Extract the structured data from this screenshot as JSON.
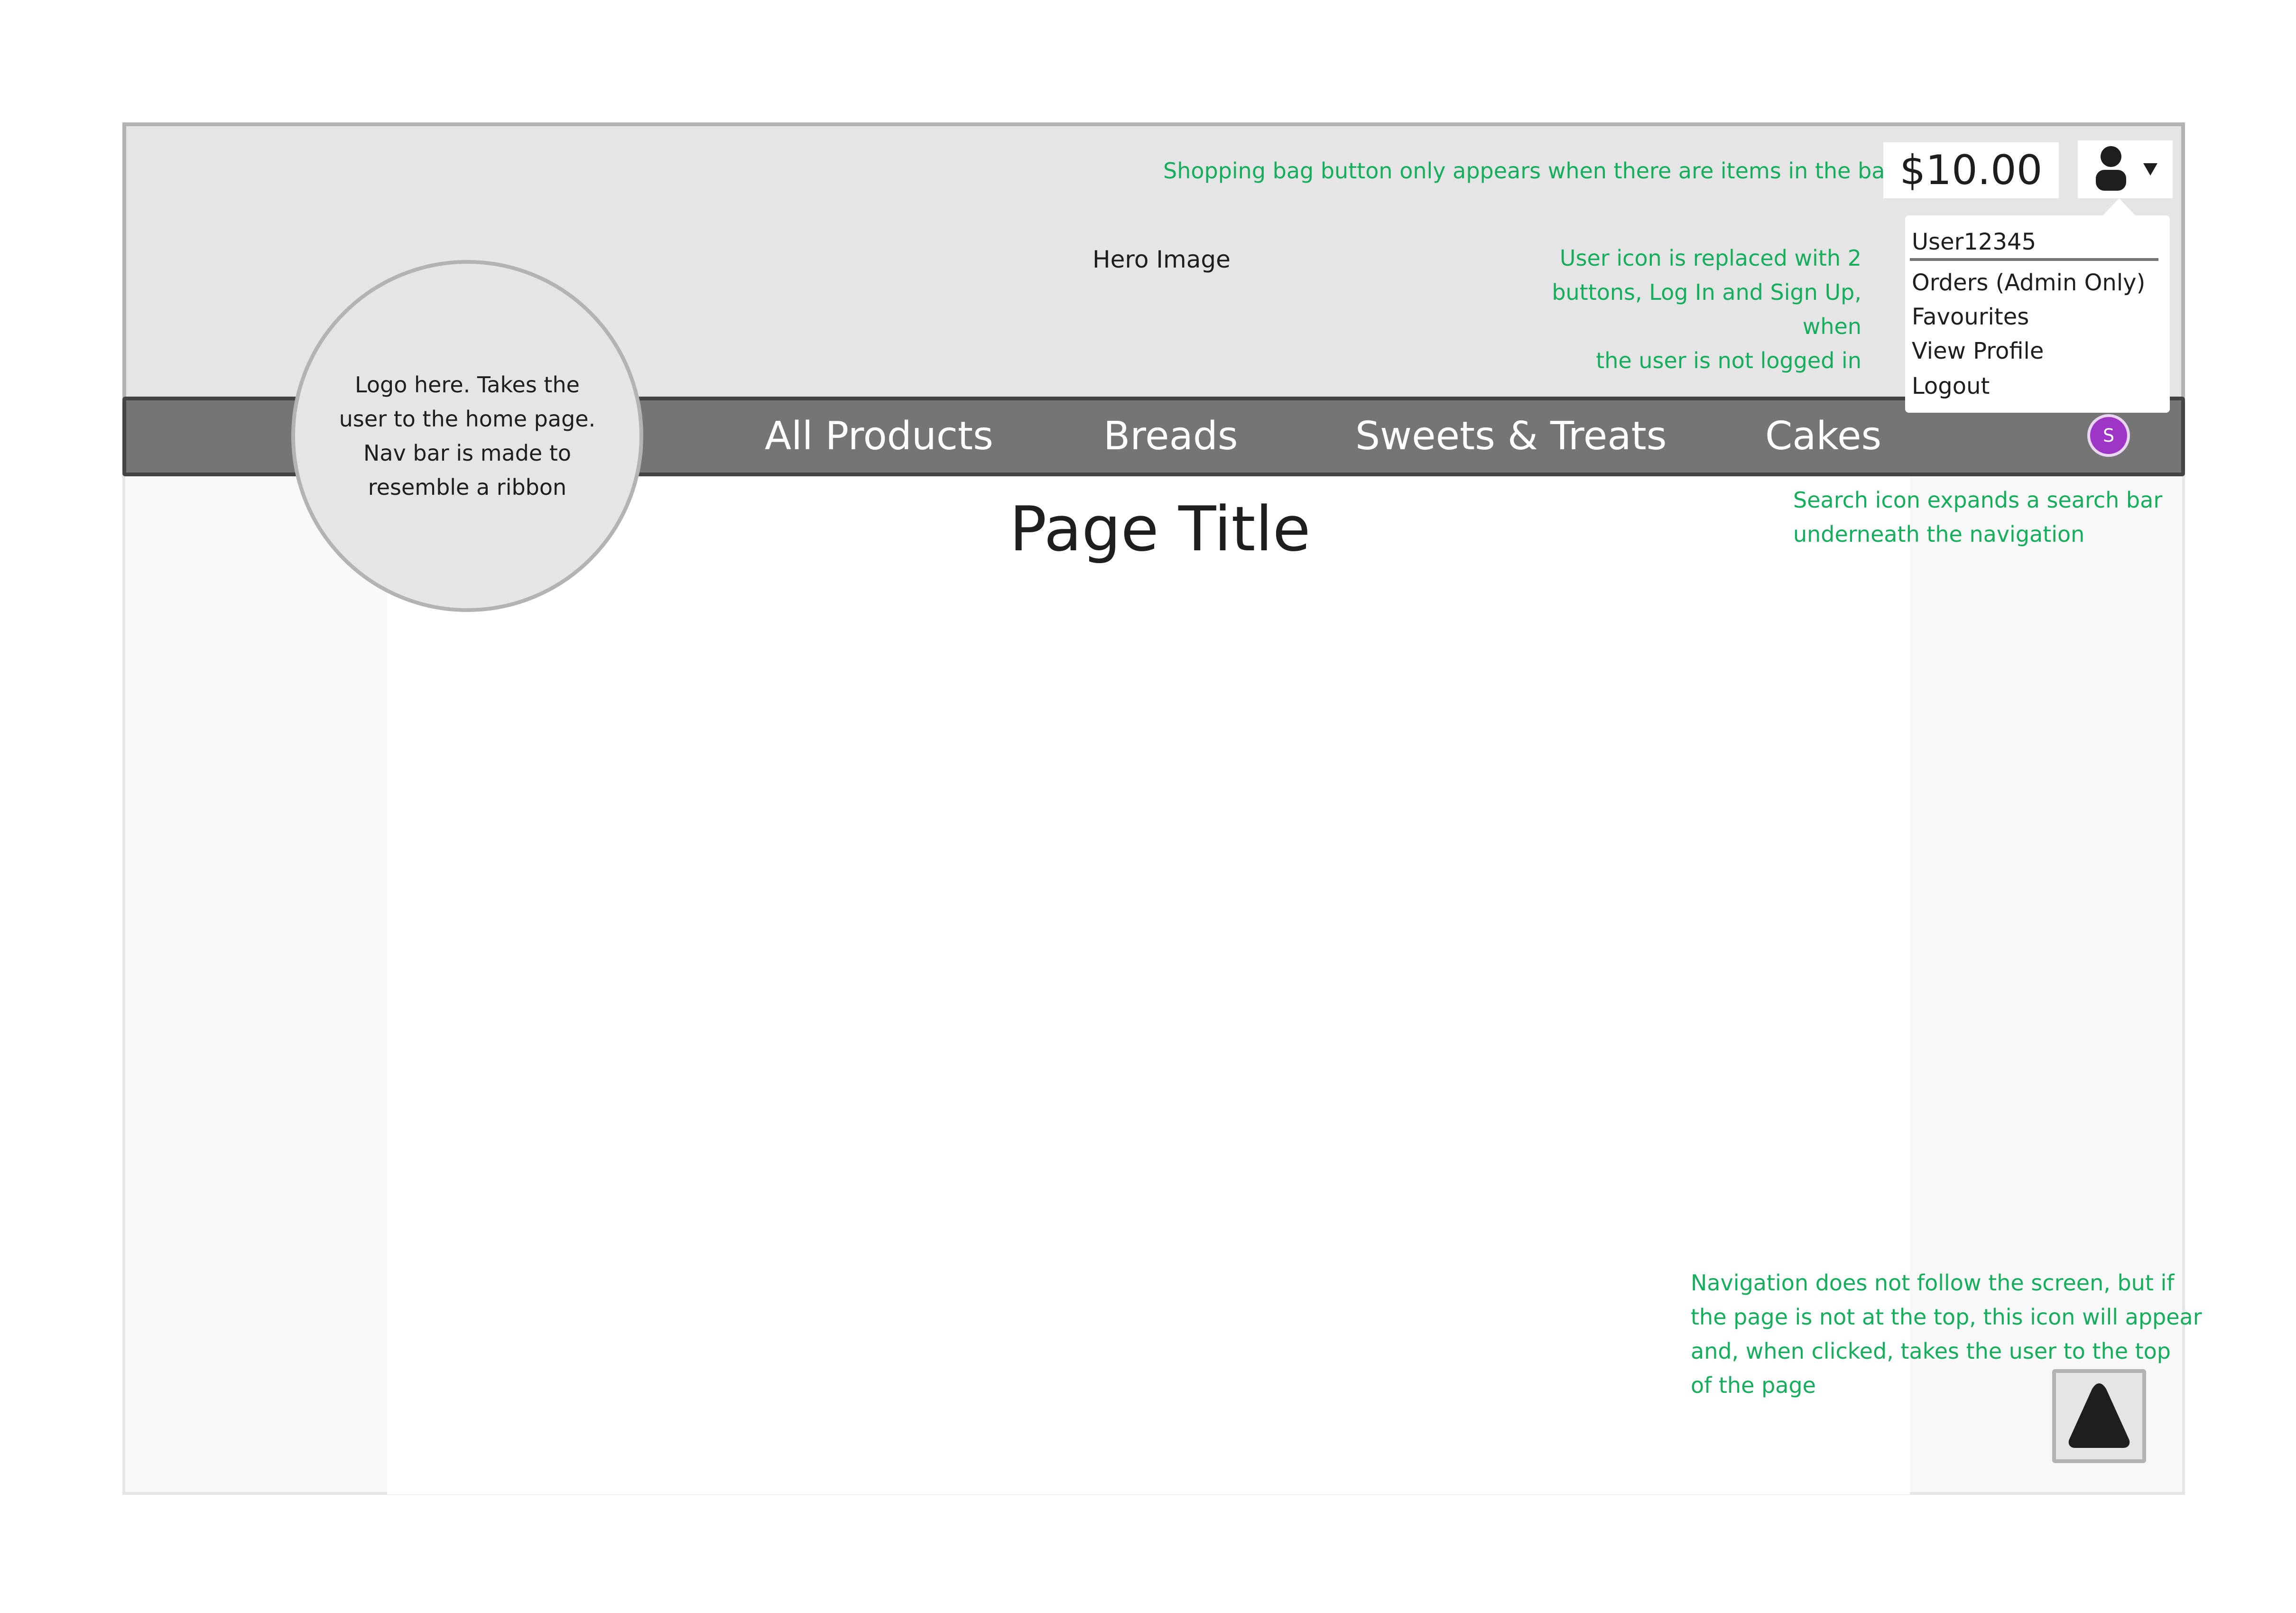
{
  "hero": {
    "label": "Hero Image"
  },
  "header": {
    "bag_total": "$10.00"
  },
  "user_menu": {
    "username": "User12345",
    "items": [
      "Orders (Admin Only)",
      "Favourites",
      "View Profile",
      "Logout"
    ]
  },
  "nav": {
    "items": [
      "All Products",
      "Breads",
      "Sweets & Treats",
      "Cakes"
    ],
    "search_letter": "S"
  },
  "logo": {
    "text": "Logo here. Takes the user to the home page. Nav bar is made to resemble a ribbon"
  },
  "main": {
    "page_title": "Page Title"
  },
  "notes": {
    "bag": "Shopping bag button only appears when there are items in the bag",
    "user_line1": "User icon is replaced with 2",
    "user_line2": "buttons, Log In and Sign Up, when",
    "user_line3": "the user is not logged in",
    "search_line1": "Search icon expands a search bar",
    "search_line2": "underneath the navigation",
    "top_line1": "Navigation does not follow the screen, but if",
    "top_line2": "the page is not at the top, this icon will appear",
    "top_line3": "and, when clicked, takes the user to the top",
    "top_line4": "of the page"
  },
  "icons": {
    "user": "user-icon",
    "caret": "caret-down-icon",
    "search": "search-icon",
    "back_to_top": "triangle-up-icon"
  },
  "colors": {
    "annotation": "#14ae5c",
    "navbar": "#757575",
    "search_button": "#9f35c7",
    "hero_background": "#e5e5e5"
  }
}
